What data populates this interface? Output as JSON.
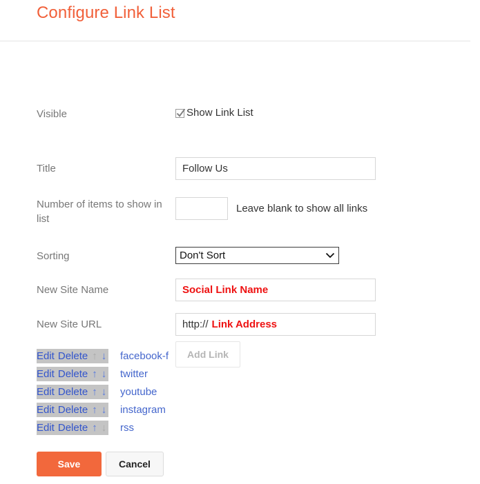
{
  "header": {
    "title": "Configure Link List"
  },
  "form": {
    "visible": {
      "label": "Visible",
      "checkbox_label": "Show Link List",
      "checked": true,
      "icon": "checkmark-icon"
    },
    "title_field": {
      "label": "Title",
      "value": "Follow Us",
      "placeholder": ""
    },
    "num_items": {
      "label": "Number of items to show in list",
      "value": "",
      "placeholder": "",
      "hint": "Leave blank to show all links"
    },
    "sorting": {
      "label": "Sorting",
      "selected": "Don't Sort",
      "caret_icon": "chevron-down-icon",
      "options": [
        "Don't Sort"
      ]
    },
    "new_site_name": {
      "label": "New Site Name",
      "value": "",
      "placeholder": "Social Link Name"
    },
    "new_site_url": {
      "label": "New Site URL",
      "value": "",
      "prefix": "http://",
      "placeholder": "Link Address"
    },
    "add_link_button": {
      "label": "Add Link"
    }
  },
  "link_list": {
    "actions": {
      "edit_label": "Edit",
      "delete_label": "Delete",
      "up_icon": "arrow-up-icon",
      "down_icon": "arrow-down-icon",
      "up_glyph": "↑",
      "down_glyph": "↓"
    },
    "rows": [
      {
        "name": "facebook-f",
        "up_enabled": false,
        "down_enabled": true
      },
      {
        "name": "twitter",
        "up_enabled": true,
        "down_enabled": true
      },
      {
        "name": "youtube",
        "up_enabled": true,
        "down_enabled": true
      },
      {
        "name": "instagram",
        "up_enabled": true,
        "down_enabled": true
      },
      {
        "name": "rss",
        "up_enabled": true,
        "down_enabled": false
      }
    ]
  },
  "footer": {
    "save_label": "Save",
    "cancel_label": "Cancel"
  },
  "colors": {
    "accent": "#f1603a",
    "save_button": "#f2683c",
    "placeholder_red": "#ee1111",
    "link_blue": "#4466cc",
    "label_grey": "#777777",
    "row_highlight": "#c4c4c4"
  }
}
